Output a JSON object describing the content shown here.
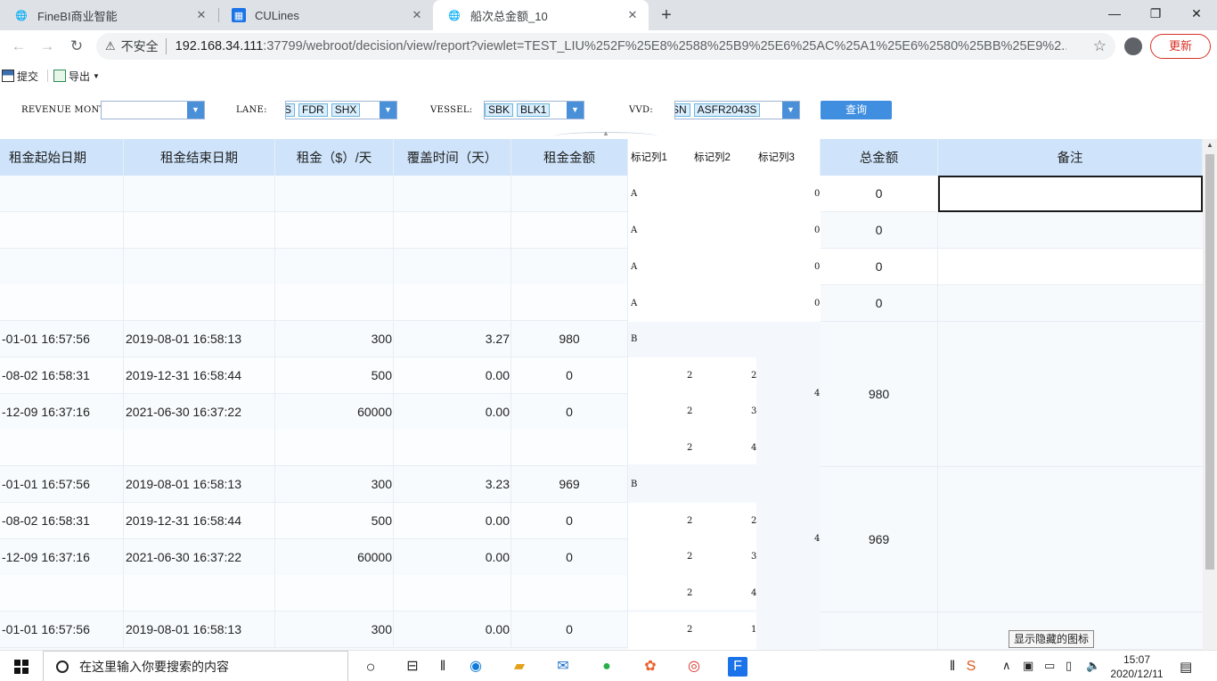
{
  "browser": {
    "tabs": [
      {
        "title": "FineBI商业智能",
        "active": false
      },
      {
        "title": "CULines",
        "active": false
      },
      {
        "title": "船次总金额_10",
        "active": true
      }
    ],
    "new_tab": "+",
    "window_controls": {
      "minimize": "—",
      "restore": "❐",
      "close": "✕"
    },
    "security_label": "不安全",
    "url_host": "192.168.34.111",
    "url_rest": ":37799/webroot/decision/view/report?viewlet=TEST_LIU%252F%25E8%2588%25B9%25E6%25AC%25A1%25E6%2580%25BB%25E9%2...",
    "update_label": "更新"
  },
  "report_toolbar": {
    "submit_label": "提交",
    "export_label": "导出"
  },
  "params": {
    "revenue_month_label": "REVENUE MONTH:",
    "revenue_month_value": "",
    "lane_label": "LANE:",
    "lane_chips": [
      "S",
      "FDR",
      "SHX"
    ],
    "vessel_label": "VESSEL:",
    "vessel_chips": [
      "SBK",
      "BLK1"
    ],
    "vvd_label": "VVD:",
    "vvd_chips": [
      "SN",
      "ASFR2043S"
    ],
    "query_label": "查询"
  },
  "table": {
    "headers": {
      "start": "租金起始日期",
      "end": "租金结束日期",
      "rate": "租金（$）/天",
      "cover": "覆盖时间（天）",
      "amount": "租金金额",
      "mark1": "标记列1",
      "mark2": "标记列2",
      "mark3": "标记列3",
      "total": "总金额",
      "remark": "备注"
    },
    "rows": [
      {
        "start": "",
        "end": "",
        "rate": "",
        "cover": "",
        "amount": ""
      },
      {
        "start": "",
        "end": "",
        "rate": "",
        "cover": "",
        "amount": ""
      },
      {
        "start": "",
        "end": "",
        "rate": "",
        "cover": "",
        "amount": ""
      },
      {
        "start": "",
        "end": "",
        "rate": "",
        "cover": "",
        "amount": ""
      },
      {
        "start": "-01-01 16:57:56",
        "end": "2019-08-01 16:58:13",
        "rate": "300",
        "cover": "3.27",
        "amount": "980"
      },
      {
        "start": "-08-02 16:58:31",
        "end": "2019-12-31 16:58:44",
        "rate": "500",
        "cover": "0.00",
        "amount": "0"
      },
      {
        "start": "-12-09 16:37:16",
        "end": "2021-06-30 16:37:22",
        "rate": "60000",
        "cover": "0.00",
        "amount": "0"
      },
      {
        "start": "",
        "end": "",
        "rate": "",
        "cover": "",
        "amount": ""
      },
      {
        "start": "-01-01 16:57:56",
        "end": "2019-08-01 16:58:13",
        "rate": "300",
        "cover": "3.23",
        "amount": "969"
      },
      {
        "start": "-08-02 16:58:31",
        "end": "2019-12-31 16:58:44",
        "rate": "500",
        "cover": "0.00",
        "amount": "0"
      },
      {
        "start": "-12-09 16:37:16",
        "end": "2021-06-30 16:37:22",
        "rate": "60000",
        "cover": "0.00",
        "amount": "0"
      },
      {
        "start": "",
        "end": "",
        "rate": "",
        "cover": "",
        "amount": ""
      },
      {
        "start": "-01-01 16:57:56",
        "end": "2019-08-01 16:58:13",
        "rate": "300",
        "cover": "0.00",
        "amount": "0"
      }
    ],
    "marks": {
      "a_rows": [
        {
          "m1": "A",
          "m3": "0"
        },
        {
          "m1": "A",
          "m3": "0"
        },
        {
          "m1": "A",
          "m3": "0"
        },
        {
          "m1": "A",
          "m3": "0"
        }
      ],
      "group1": {
        "m1": "B",
        "m3_merged": "4",
        "subrows": [
          {
            "m2": "2",
            "m3": "2"
          },
          {
            "m2": "2",
            "m3": "3"
          },
          {
            "m2": "2",
            "m3": "4"
          }
        ]
      },
      "group2": {
        "m1": "B",
        "m3_merged": "4",
        "subrows": [
          {
            "m2": "2",
            "m3": "2"
          },
          {
            "m2": "2",
            "m3": "3"
          },
          {
            "m2": "2",
            "m3": "4"
          }
        ]
      },
      "last": {
        "m2": "2",
        "m3": "1"
      }
    },
    "totals": [
      "0",
      "0",
      "0",
      "0",
      "980",
      "969"
    ]
  },
  "tooltip": "显示隐藏的图标",
  "taskbar": {
    "search_placeholder": "在这里输入你要搜索的内容",
    "time": "15:07",
    "date": "2020/12/11"
  },
  "colors": {
    "header_bg": "#cfe4fb",
    "query_btn": "#3f8ee0",
    "chip_bg": "#d9efff",
    "update_red": "#d93025"
  }
}
